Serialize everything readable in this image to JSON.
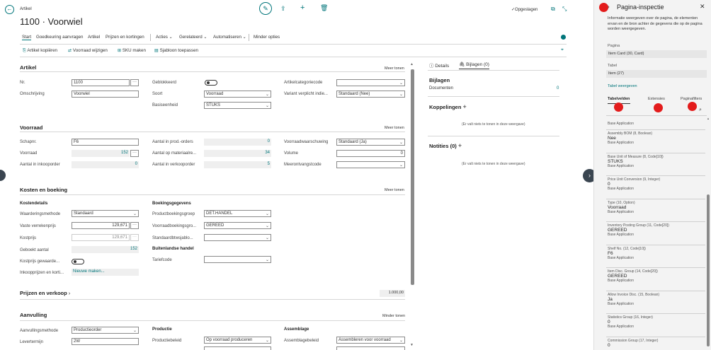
{
  "header": {
    "breadcrumb": "Artikel",
    "title": "1100 · Voorwiel",
    "saved": "Opgeslagen"
  },
  "menu": {
    "items": [
      "Start",
      "Goedkeuring aanvragen",
      "Artikel",
      "Prijzen en kortingen",
      "Acties",
      "Gerelateerd",
      "Automatiseren",
      "Minder opties"
    ]
  },
  "actions": [
    "Artikel kopiëren",
    "Voorraad wijzigen",
    "SKU maken",
    "Sjabloon toepassen"
  ],
  "artikel": {
    "title": "Artikel",
    "meer": "Meer tonen",
    "nr_label": "Nr.",
    "nr_value": "1100",
    "omschrijving_label": "Omschrijving",
    "omschrijving_value": "Voorwiel",
    "geblokkeerd_label": "Geblokkeerd",
    "soort_label": "Soort",
    "soort_value": "Voorraad",
    "basiseenheid_label": "Basiseenheid",
    "basiseenheid_value": "STUKS",
    "categorie_label": "Artikelcategoriecode",
    "categorie_value": "",
    "variant_label": "Variant verplicht indie...",
    "variant_value": "Standaard (Nee)"
  },
  "voorraad": {
    "title": "Voorraad",
    "meer": "Meer tonen",
    "schapnr_label": "Schapnr.",
    "schapnr_value": "F6",
    "voorraad_label": "Voorraad",
    "voorraad_value": "152",
    "inkooporder_label": "Aantal in inkooporder",
    "inkooporder_value": "0",
    "prodorders_label": "Aantal in prod.-orders",
    "prodorders_value": "0",
    "materiaal_label": "Aantal op materiaalre...",
    "materiaal_value": "34",
    "verkoop_label": "Aantal in verkooporder",
    "verkoop_value": "5",
    "waarschuwing_label": "Voorraadwaarschuwing",
    "waarschuwing_value": "Standaard (Ja)",
    "volume_label": "Volume",
    "volume_value": "0",
    "meerontvangst_label": "Meerontvangstcode",
    "meerontvangst_value": ""
  },
  "kosten": {
    "title": "Kosten en boeking",
    "meer": "Meer tonen",
    "kostendetails": "Kostendetails",
    "waardering_label": "Waarderingsmethode",
    "waardering_value": "Standaard",
    "vaste_label": "Vaste verrekenprijs",
    "vaste_value": "129,671",
    "kostprijs_label": "Kostprijs",
    "kostprijs_value": "129,671",
    "geboekt_label": "Geboekt aantal",
    "geboekt_value": "152",
    "gehwaard_label": "Kostprijs gewaarde...",
    "inkoopprijzen_label": "Inkoopprijzen en korti...",
    "inkoopprijzen_value": "Nieuwe maken...",
    "boekingsgegevens": "Boekingsgegevens",
    "prodboek_label": "Productboekingsgroep",
    "prodboek_value": "DET.HANDEL",
    "voorraadboek_label": "Voorraadboekingsgro...",
    "voorraadboek_value": "GEREED",
    "btw_label": "Standaardbtwsjablo...",
    "btw_value": "",
    "buitenlandse": "Buitenlandse handel",
    "tarief_label": "Tariefcode",
    "tarief_value": ""
  },
  "prijzen": {
    "title": "Prijzen en verkoop",
    "value": "1.000,00"
  },
  "aanvulling": {
    "title": "Aanvulling",
    "meer": "Minder tonen",
    "methode_label": "Aanvullingsmethode",
    "methode_value": "Productieorder",
    "levertermijn_label": "Levertermijn",
    "levertermijn_value": "2W",
    "productie": "Productie",
    "productiebeleid_label": "Productiebeleid",
    "productiebeleid_value": "Op voorraad produceren",
    "assemblage": "Assemblage",
    "assemblagebeleid_label": "Assemblagebeleid",
    "assemblagebeleid_value": "Assembleren voor voorraad"
  },
  "factbox": {
    "tab_details": "Details",
    "tab_bijlagen": "Bijlagen (0)",
    "bijlagen_title": "Bijlagen",
    "documenten_label": "Documenten",
    "documenten_value": "0",
    "koppelingen": "Koppelingen",
    "empty1": "(Er valt niets te tonen in deze weergave)",
    "notities": "Notities (0)",
    "empty2": "(Er valt niets te tonen in deze weergave)"
  },
  "inspector": {
    "title": "Pagina-inspectie",
    "description": "Informatie weergeven over de pagina, de elementen ervan en de bron achter de gegevens die op de pagina worden weergegeven.",
    "pagina_label": "Pagina",
    "pagina_value": "Item Card (30, Card)",
    "tabel_label": "Tabel",
    "tabel_value": "Item (27)",
    "tabel_link": "Tabel weergeven",
    "tabs": [
      "Tabelvelden",
      "Extensies",
      "Paginafilters"
    ],
    "first_source": "Base Application",
    "fields": [
      {
        "key": "Assembly BOM (8, Boolean)",
        "value": "Nee",
        "source": "Base Application"
      },
      {
        "key": "Base Unit of Measure (8, Code[10])",
        "value": "STUKS",
        "source": "Base Application"
      },
      {
        "key": "Price Unit Conversion (9, Integer)",
        "value": "0",
        "source": "Base Application"
      },
      {
        "key": "Type (10, Option)",
        "value": "Voorraad",
        "source": "Base Application"
      },
      {
        "key": "Inventory Posting Group (11, Code[20])",
        "value": "GEREED",
        "source": "Base Application"
      },
      {
        "key": "Shelf No. (12, Code[10])",
        "value": "F6",
        "source": "Base Application"
      },
      {
        "key": "Item Disc. Group (14, Code[20])",
        "value": "GEREED",
        "source": "Base Application"
      },
      {
        "key": "Allow Invoice Disc. (15, Boolean)",
        "value": "Ja",
        "source": "Base Application"
      },
      {
        "key": "Statistics Group (16, Integer)",
        "value": "0",
        "source": "Base Application"
      },
      {
        "key": "Commission Group (17, Integer)",
        "value": "0",
        "source": ""
      }
    ]
  },
  "colors": {
    "accent": "#00757a",
    "marker": "#e31b1b",
    "inspector_bg": "#f3f3f3"
  }
}
